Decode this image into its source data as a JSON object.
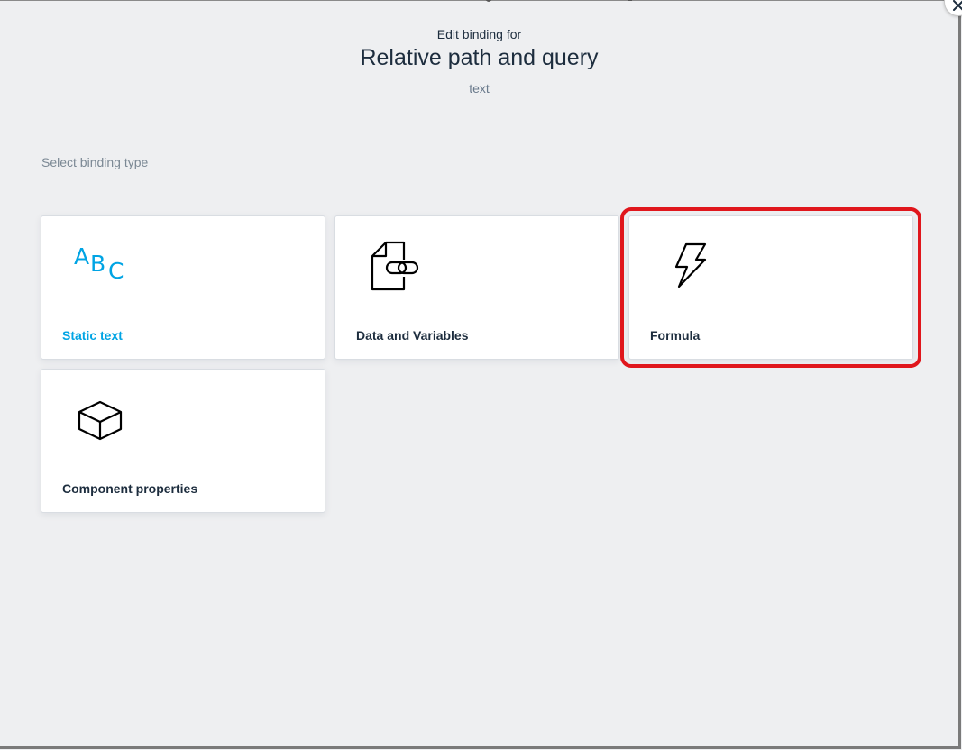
{
  "dialog": {
    "eyebrow": "Edit binding for",
    "title": "Relative path and query",
    "subtitle": "text",
    "close_icon": "close-icon"
  },
  "section_label": "Select binding type",
  "cards": [
    {
      "label": "Static text",
      "icon": "abc-icon",
      "selected": false
    },
    {
      "label": "Data and Variables",
      "icon": "document-link-icon",
      "selected": false
    },
    {
      "label": "Formula",
      "icon": "lightning-icon",
      "selected": true
    },
    {
      "label": "Component properties",
      "icon": "cube-icon",
      "selected": false
    }
  ],
  "colors": {
    "accent": "#00a4e4",
    "highlight": "#e0161c",
    "background": "#eeeff1",
    "text": "#1d2d3e"
  }
}
